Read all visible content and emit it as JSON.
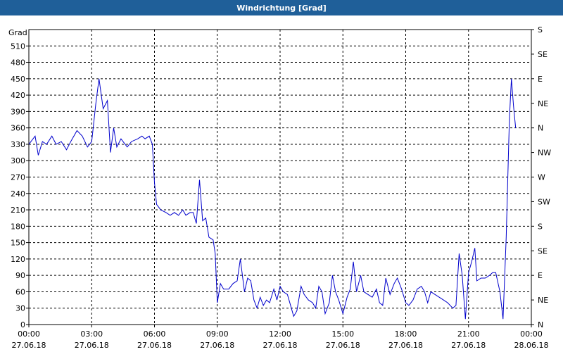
{
  "window": {
    "title": "Windrichtung [Grad]"
  },
  "chart_data": {
    "type": "line",
    "title": "Windrichtung [Grad]",
    "ylabel": "Grad",
    "xlabel": "",
    "ylim": [
      0,
      540
    ],
    "y_ticks": [
      0,
      30,
      60,
      90,
      120,
      150,
      180,
      210,
      240,
      270,
      300,
      330,
      360,
      390,
      420,
      450,
      480,
      510
    ],
    "right_axis_labels": [
      "N",
      "NE",
      "E",
      "SE",
      "S",
      "SW",
      "W",
      "NW",
      "N",
      "NE",
      "E",
      "SE",
      "S"
    ],
    "x_ticks": [
      {
        "time": "00:00",
        "date": "27.06.18"
      },
      {
        "time": "03:00",
        "date": "27.06.18"
      },
      {
        "time": "06:00",
        "date": "27.06.18"
      },
      {
        "time": "09:00",
        "date": "27.06.18"
      },
      {
        "time": "12:00",
        "date": "27.06.18"
      },
      {
        "time": "15:00",
        "date": "27.06.18"
      },
      {
        "time": "18:00",
        "date": "27.06.18"
      },
      {
        "time": "21:00",
        "date": "27.06.18"
      },
      {
        "time": "00:00",
        "date": "28.06.18"
      }
    ],
    "xlim_hours": [
      0,
      24
    ],
    "grid": true,
    "series": [
      {
        "color": "#0000cc",
        "points": [
          [
            0.0,
            330
          ],
          [
            0.3,
            345
          ],
          [
            0.45,
            310
          ],
          [
            0.65,
            335
          ],
          [
            0.85,
            330
          ],
          [
            1.1,
            345
          ],
          [
            1.3,
            330
          ],
          [
            1.55,
            335
          ],
          [
            1.8,
            320
          ],
          [
            2.0,
            335
          ],
          [
            2.3,
            355
          ],
          [
            2.55,
            345
          ],
          [
            2.8,
            325
          ],
          [
            3.0,
            335
          ],
          [
            3.2,
            405
          ],
          [
            3.35,
            450
          ],
          [
            3.55,
            395
          ],
          [
            3.75,
            410
          ],
          [
            3.9,
            315
          ],
          [
            4.05,
            360
          ],
          [
            4.2,
            325
          ],
          [
            4.4,
            340
          ],
          [
            4.7,
            325
          ],
          [
            4.9,
            335
          ],
          [
            5.2,
            340
          ],
          [
            5.4,
            345
          ],
          [
            5.55,
            340
          ],
          [
            5.75,
            345
          ],
          [
            5.9,
            330
          ],
          [
            6.0,
            260
          ],
          [
            6.1,
            220
          ],
          [
            6.3,
            210
          ],
          [
            6.55,
            205
          ],
          [
            6.75,
            200
          ],
          [
            6.95,
            205
          ],
          [
            7.15,
            200
          ],
          [
            7.35,
            210
          ],
          [
            7.5,
            200
          ],
          [
            7.7,
            205
          ],
          [
            7.85,
            205
          ],
          [
            8.0,
            185
          ],
          [
            8.15,
            265
          ],
          [
            8.3,
            190
          ],
          [
            8.45,
            195
          ],
          [
            8.6,
            160
          ],
          [
            8.8,
            155
          ],
          [
            8.9,
            130
          ],
          [
            9.0,
            40
          ],
          [
            9.15,
            75
          ],
          [
            9.3,
            65
          ],
          [
            9.55,
            65
          ],
          [
            9.75,
            75
          ],
          [
            9.95,
            80
          ],
          [
            10.1,
            120
          ],
          [
            10.3,
            60
          ],
          [
            10.45,
            85
          ],
          [
            10.6,
            80
          ],
          [
            10.75,
            45
          ],
          [
            10.9,
            30
          ],
          [
            11.05,
            50
          ],
          [
            11.2,
            35
          ],
          [
            11.35,
            45
          ],
          [
            11.5,
            40
          ],
          [
            11.7,
            65
          ],
          [
            11.85,
            45
          ],
          [
            12.0,
            70
          ],
          [
            12.15,
            60
          ],
          [
            12.35,
            55
          ],
          [
            12.5,
            35
          ],
          [
            12.65,
            15
          ],
          [
            12.8,
            25
          ],
          [
            13.0,
            70
          ],
          [
            13.15,
            55
          ],
          [
            13.35,
            45
          ],
          [
            13.55,
            40
          ],
          [
            13.7,
            30
          ],
          [
            13.85,
            70
          ],
          [
            14.0,
            60
          ],
          [
            14.15,
            20
          ],
          [
            14.35,
            40
          ],
          [
            14.5,
            90
          ],
          [
            14.65,
            60
          ],
          [
            14.8,
            45
          ],
          [
            15.0,
            20
          ],
          [
            15.2,
            50
          ],
          [
            15.35,
            65
          ],
          [
            15.5,
            115
          ],
          [
            15.65,
            60
          ],
          [
            15.85,
            90
          ],
          [
            16.0,
            60
          ],
          [
            16.2,
            55
          ],
          [
            16.4,
            50
          ],
          [
            16.6,
            65
          ],
          [
            16.75,
            40
          ],
          [
            16.9,
            35
          ],
          [
            17.05,
            85
          ],
          [
            17.25,
            55
          ],
          [
            17.45,
            75
          ],
          [
            17.6,
            85
          ],
          [
            17.8,
            65
          ],
          [
            18.0,
            40
          ],
          [
            18.15,
            35
          ],
          [
            18.35,
            45
          ],
          [
            18.55,
            65
          ],
          [
            18.75,
            70
          ],
          [
            18.9,
            60
          ],
          [
            19.05,
            40
          ],
          [
            19.2,
            60
          ],
          [
            19.4,
            55
          ],
          [
            19.6,
            50
          ],
          [
            19.8,
            45
          ],
          [
            20.0,
            40
          ],
          [
            20.25,
            30
          ],
          [
            20.4,
            35
          ],
          [
            20.55,
            130
          ],
          [
            20.7,
            90
          ],
          [
            20.85,
            10
          ],
          [
            21.0,
            95
          ],
          [
            21.15,
            115
          ],
          [
            21.3,
            140
          ],
          [
            21.4,
            80
          ],
          [
            21.6,
            85
          ],
          [
            21.8,
            85
          ],
          [
            22.0,
            90
          ],
          [
            22.15,
            95
          ],
          [
            22.3,
            95
          ],
          [
            22.5,
            60
          ],
          [
            22.65,
            10
          ],
          [
            22.8,
            160
          ],
          [
            22.95,
            375
          ],
          [
            23.05,
            450
          ],
          [
            23.15,
            400
          ],
          [
            23.25,
            360
          ]
        ]
      }
    ]
  }
}
